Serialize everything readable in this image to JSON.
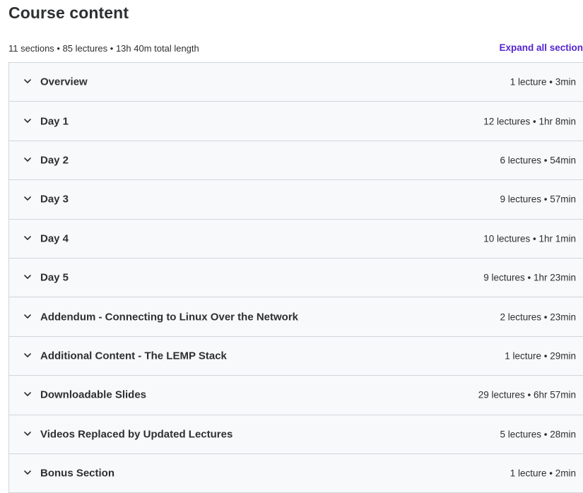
{
  "header": {
    "title": "Course content",
    "summary": "11 sections • 85 lectures • 13h 40m total length",
    "expand_label": "Expand all section"
  },
  "sections": [
    {
      "title": "Overview",
      "meta": "1 lecture • 3min",
      "icon": "chevron-down-icon"
    },
    {
      "title": "Day 1",
      "meta": "12 lectures • 1hr 8min",
      "icon": "chevron-down-icon"
    },
    {
      "title": "Day 2",
      "meta": "6 lectures • 54min",
      "icon": "chevron-down-icon"
    },
    {
      "title": "Day 3",
      "meta": "9 lectures • 57min",
      "icon": "chevron-down-icon"
    },
    {
      "title": "Day 4",
      "meta": "10 lectures • 1hr 1min",
      "icon": "chevron-down-icon"
    },
    {
      "title": "Day 5",
      "meta": "9 lectures • 1hr 23min",
      "icon": "chevron-down-icon"
    },
    {
      "title": "Addendum - Connecting to Linux Over the Network",
      "meta": "2 lectures • 23min",
      "icon": "chevron-down-icon"
    },
    {
      "title": "Additional Content - The LEMP Stack",
      "meta": "1 lecture • 29min",
      "icon": "chevron-down-icon"
    },
    {
      "title": "Downloadable Slides",
      "meta": "29 lectures • 6hr 57min",
      "icon": "chevron-down-icon"
    },
    {
      "title": "Videos Replaced by Updated Lectures",
      "meta": "5 lectures • 28min",
      "icon": "chevron-down-icon"
    },
    {
      "title": "Bonus Section",
      "meta": "1 lecture • 2min",
      "icon": "chevron-down-icon"
    }
  ],
  "colors": {
    "text": "#2d2f31",
    "accent": "#5624d0",
    "row_bg": "#f7f9fa",
    "border": "#d1d7dc"
  }
}
